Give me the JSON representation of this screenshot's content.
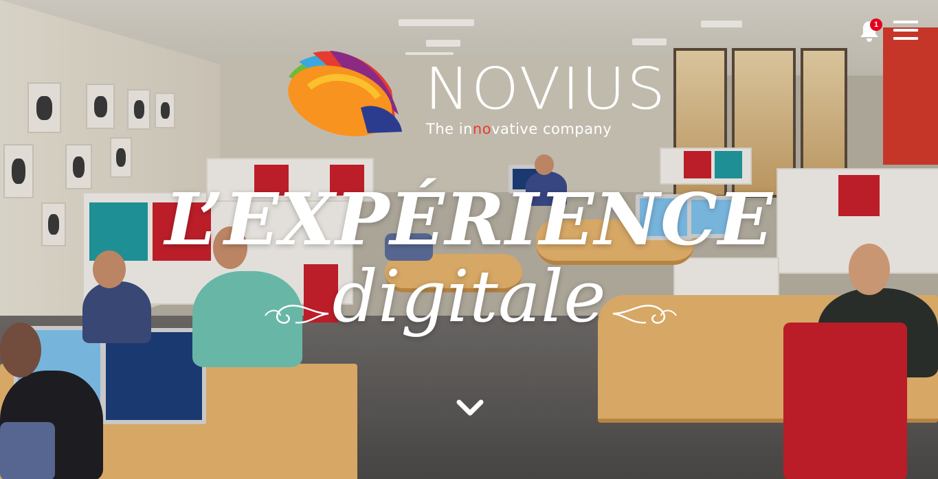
{
  "logo": {
    "brand": "NOVIUS",
    "tagline_parts": [
      "The ",
      "in",
      "no",
      "v",
      "ative company"
    ],
    "tagline_accent_index": 2,
    "colors": {
      "orange": "#f7931e",
      "red": "#e63b2e",
      "blue": "#2b3c8f",
      "green": "#6dbb3b",
      "purple": "#8a2a85"
    }
  },
  "header": {
    "notifications": {
      "icon": "bell-icon",
      "count": "1"
    },
    "menu": {
      "icon": "hamburger-menu-icon"
    }
  },
  "hero": {
    "headline": "L’EXPÉRIENCE",
    "subline": "digitale",
    "scroll_icon": "chevron-down-icon"
  }
}
